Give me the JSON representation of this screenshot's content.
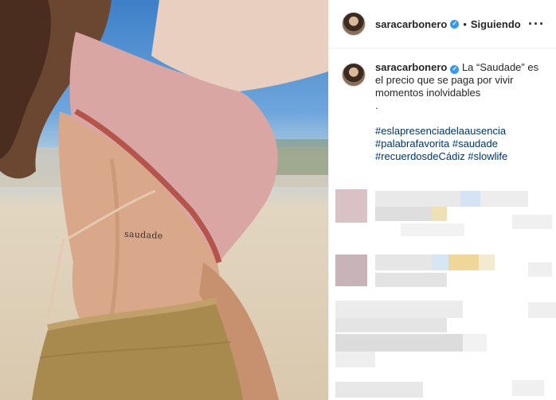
{
  "photo": {
    "tattoo_text": "saudade"
  },
  "header": {
    "username": "saracarbonero",
    "separator": "•",
    "follow_label": "Siguiendo",
    "more_label": "···"
  },
  "caption": {
    "username": "saracarbonero",
    "text": "La “Saudade” es el precio que se paga por vivir momentos inolvidables",
    "dot": ".",
    "hashtags": [
      "#eslapresenciadelaausencia",
      "#palabrafavorita",
      "#saudade",
      "#recuerdosdeCádiz",
      "#slowlife"
    ]
  },
  "colors": {
    "verified": "#3897f0",
    "hashtag": "#003569",
    "divider": "#efefef"
  },
  "icons": {
    "verified": "verified-badge-icon",
    "more": "more-options-icon"
  }
}
